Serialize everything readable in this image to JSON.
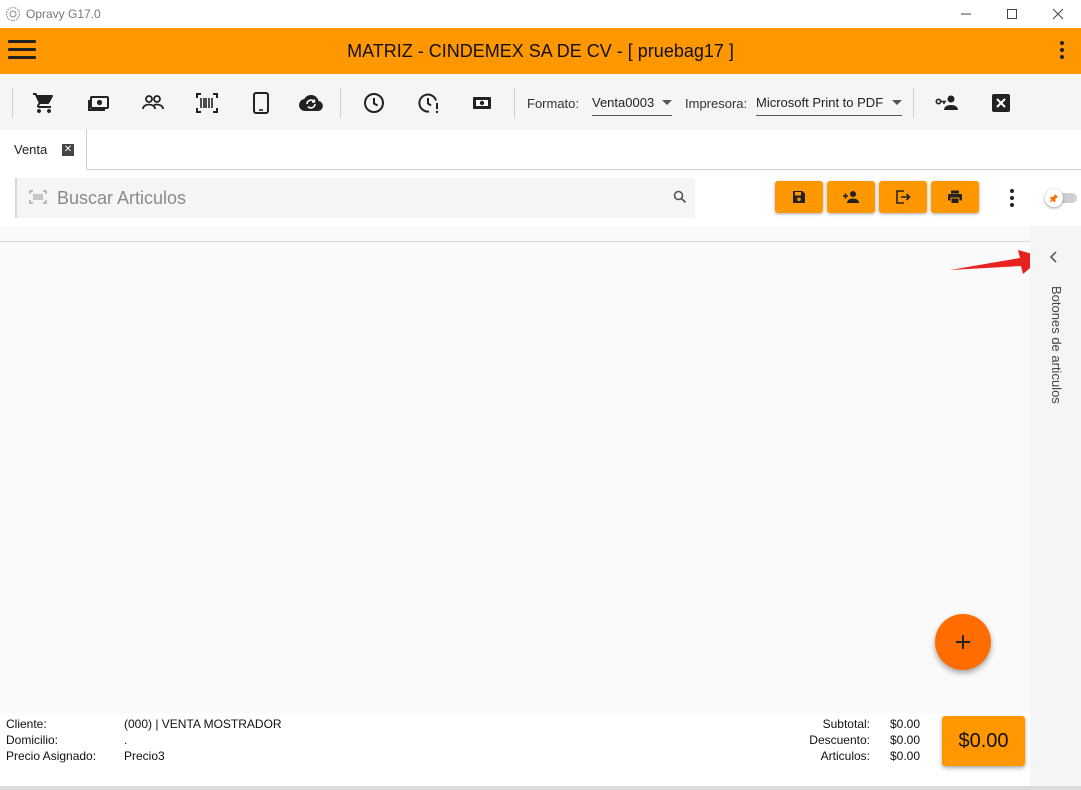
{
  "window": {
    "title": "Opravy G17.0",
    "controls": [
      "minimize-icon",
      "maximize-icon",
      "close-icon"
    ]
  },
  "header": {
    "title": "MATRIZ - CINDEMEX SA DE CV - [ pruebag17 ]",
    "background": "#ff9800"
  },
  "toolbar": {
    "icons": [
      "cart-icon",
      "cash-icon",
      "people-icon",
      "barcode-icon",
      "tablet-icon",
      "cloud-sync-icon",
      "clock-icon",
      "clock-alert-icon",
      "money-icon",
      "user-key-icon",
      "close-box-icon"
    ],
    "formato_label": "Formato:",
    "formato_value": "Venta0003",
    "impresora_label": "Impresora:",
    "impresora_value": "Microsoft Print to PDF"
  },
  "tabs": [
    {
      "label": "Venta",
      "active": true
    }
  ],
  "search": {
    "placeholder": "Buscar Articulos",
    "value": ""
  },
  "actions": [
    "save-icon",
    "add-user-icon",
    "exit-icon",
    "print-icon"
  ],
  "side_panel": {
    "label": "Botones de articulos"
  },
  "footer": {
    "cliente_label": "Cliente:",
    "cliente_value": "(000) | VENTA MOSTRADOR",
    "domicilio_label": "Domicilio:",
    "domicilio_value": ".",
    "precio_label": "Precio Asignado:",
    "precio_value": "Precio3",
    "subtotal_label": "Subtotal:",
    "subtotal_value": "$0.00",
    "descuento_label": "Descuento:",
    "descuento_value": "$0.00",
    "articulos_label": "Articulos:",
    "articulos_value": "$0.00",
    "total": "$0.00"
  },
  "colors": {
    "accent": "#ff9800",
    "fab": "#ff6d00",
    "annotation_arrow": "#e8221f"
  }
}
